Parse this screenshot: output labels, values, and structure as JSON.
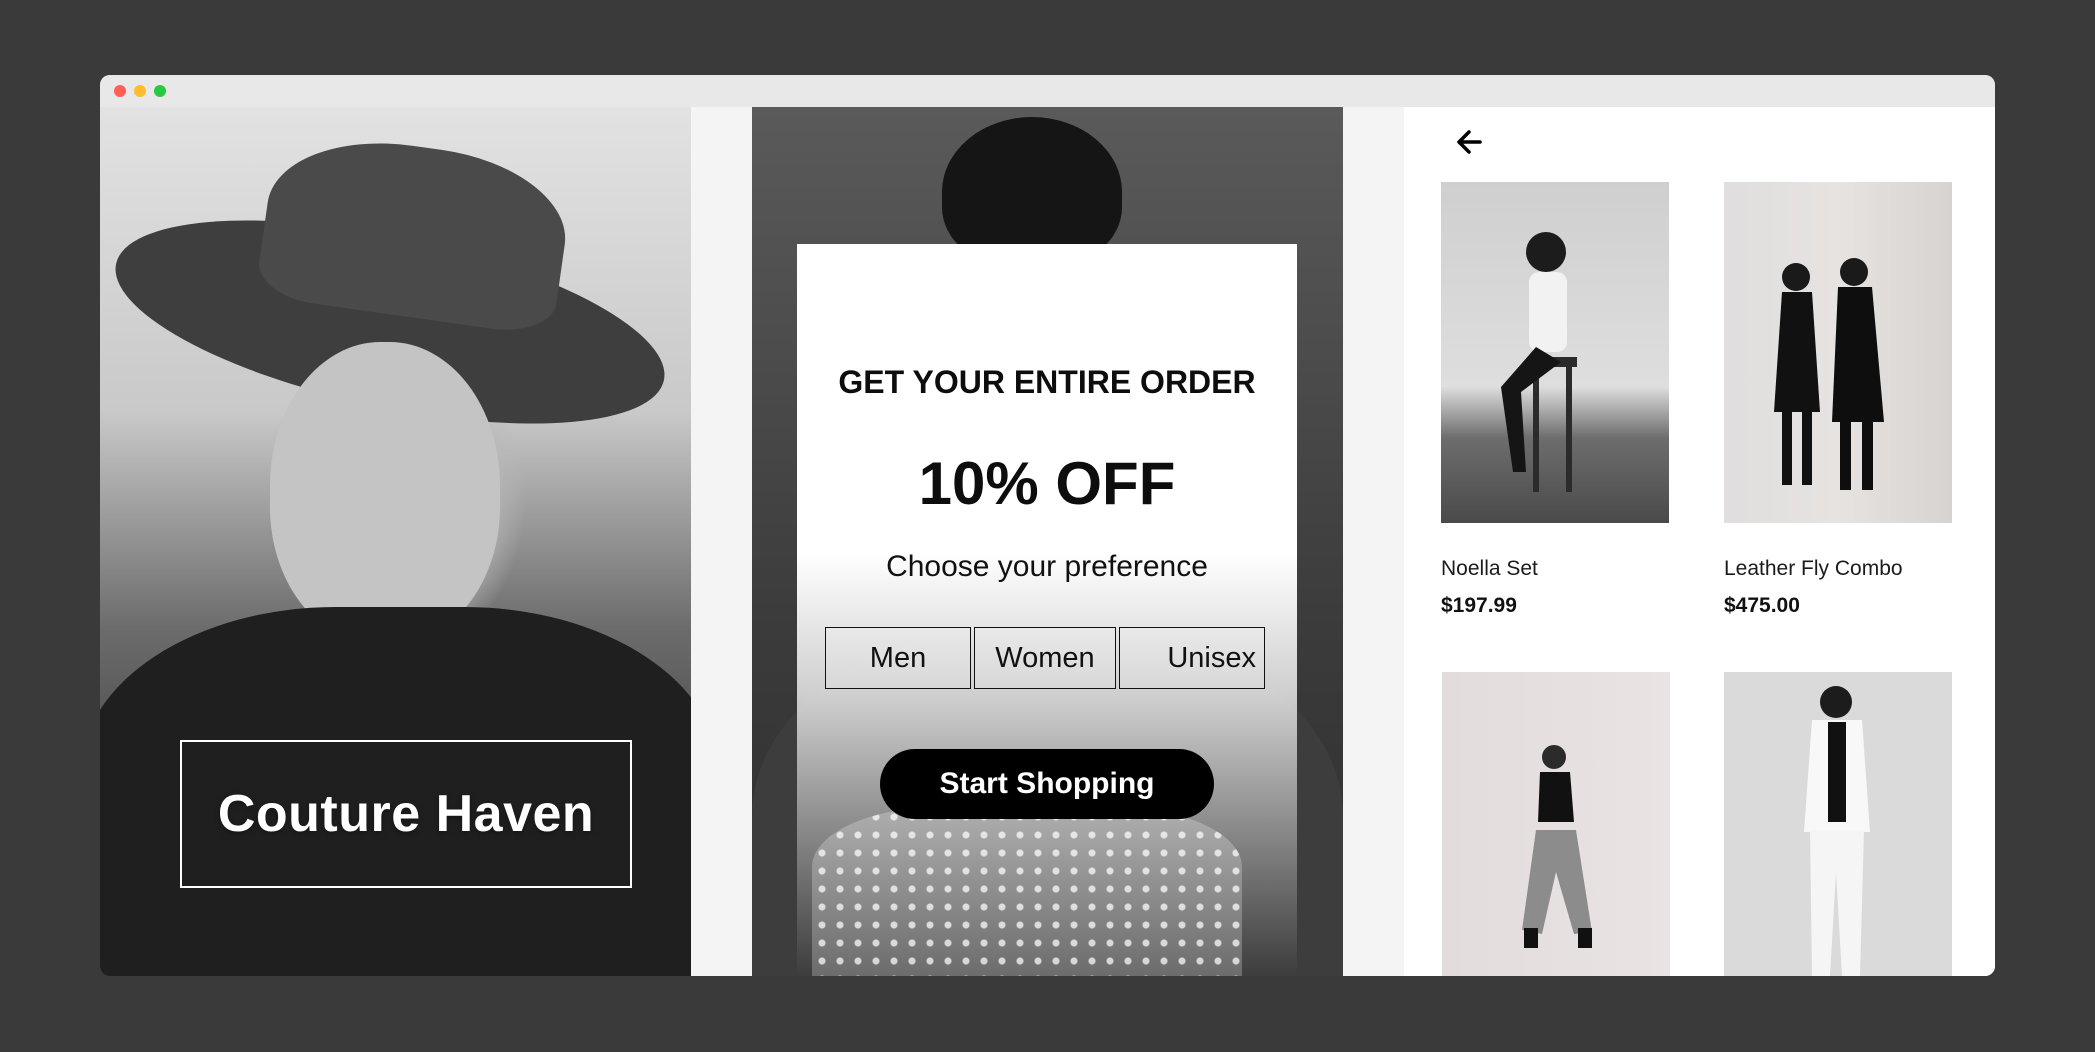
{
  "window": {
    "controls": [
      "close",
      "minimize",
      "maximize"
    ]
  },
  "left_panel": {
    "brand_name": "Couture Haven"
  },
  "promo": {
    "heading": "GET YOUR ENTIRE ORDER",
    "discount": "10% OFF",
    "subheading": "Choose your preference",
    "preferences": [
      "Men",
      "Women",
      "Unisex"
    ],
    "cta_label": "Start Shopping"
  },
  "catalog": {
    "back_icon": "arrow-left-icon",
    "products": [
      {
        "name": "Noella Set",
        "price": "$197.99"
      },
      {
        "name": "Leather Fly Combo",
        "price": "$475.00"
      },
      {
        "name": "",
        "price": ""
      },
      {
        "name": "",
        "price": ""
      }
    ]
  },
  "colors": {
    "background": "#3a3a3a",
    "cta": "#000000",
    "text_primary": "#111111"
  }
}
